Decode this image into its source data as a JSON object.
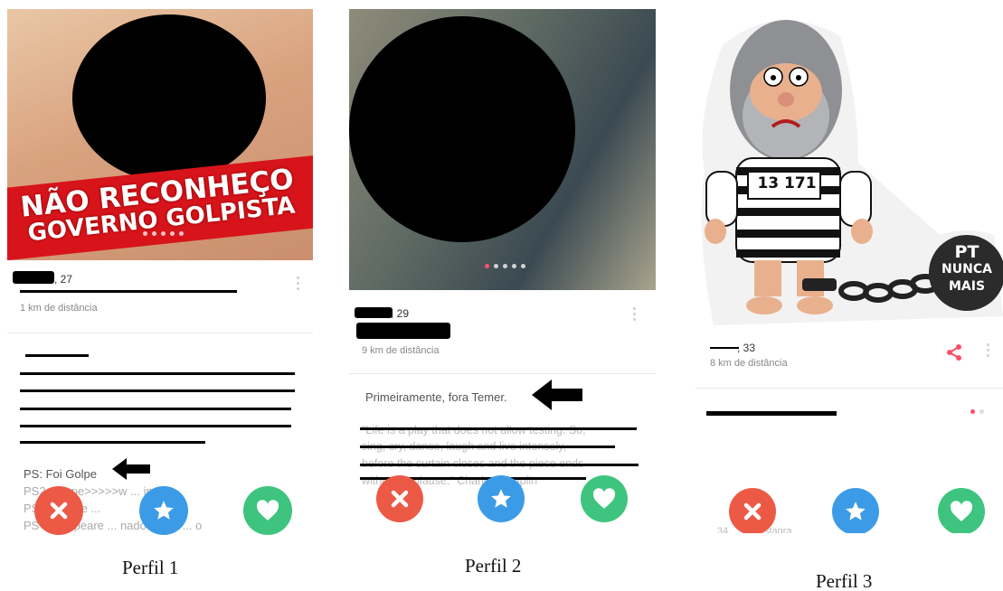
{
  "captions": [
    "Perfil 1",
    "Perfil 2",
    "Perfil 3"
  ],
  "profile1": {
    "banner_line1": "NÃO RECONHEÇO",
    "banner_line2": "GOVERNO GOLPISTA",
    "age": ", 27",
    "distance": "1 km de distância",
    "bio_visible_line": "PS: Foi Golpe",
    "bio_partial": [
      "PS2 ... lope>>>>>w ... ine",
      "PS ... vende ...",
      "PS ... kespeare ... nado não h ... o"
    ]
  },
  "profile2": {
    "age": ", 29",
    "distance": "9 km de distância",
    "bio_visible_line": "Primeiramente, fora Temer.",
    "quote_lines": [
      "\"Life is a play that does not allow testing. So,",
      "sing, cry, dance, laugh and live intensely,",
      "before the curtain closes and the piece ends",
      "without applause.\" Charles Chaplin"
    ]
  },
  "profile3": {
    "prisoner_number": "13 171",
    "ball_text": [
      "PT",
      "NUNCA",
      "MAIS"
    ],
    "age": ", 33",
    "distance": "8 km de distância",
    "instagram_partial": "34 ... do Instagra"
  },
  "colors": {
    "nope": "#ec5a46",
    "super_like": "#3c9be6",
    "like": "#3ec47e",
    "share": "#fd5068",
    "banner_red": "#d8141b"
  },
  "icons": {
    "nope": "close-icon",
    "super_like": "star-icon",
    "like": "heart-icon",
    "share": "share-icon",
    "menu": "kebab-menu-icon",
    "pointer": "arrow-left-icon"
  }
}
